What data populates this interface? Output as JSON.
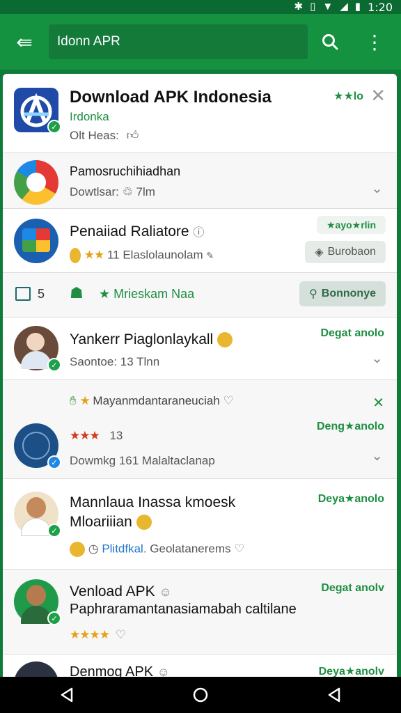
{
  "status_bar": {
    "time": "1:20"
  },
  "app_bar": {
    "search_text": "Idonn APR"
  },
  "rows": [
    {
      "title": "Download APK Indonesia",
      "subtitle": "Irdonka",
      "meta": "Olt Heas:",
      "right_label": "★★lo"
    },
    {
      "title": "Pamosruchihiadhan",
      "meta": "Dowtlsar: ♲ 7lm"
    },
    {
      "title": "Penaiiad Raliatore",
      "meta": "11  Elaslolaunolam",
      "pill_top": "★ayo★rlin",
      "pill_bottom": "Burobaon"
    },
    {
      "count": "5",
      "category": "Mrieskam Naa",
      "button": "Bonnonye"
    },
    {
      "title": "Yankerr Piaglonlaykall",
      "meta": "Saontoe:  13 Tlnn",
      "right_label": "Degat anolo"
    },
    {
      "title": "Mayanmdantaraneuciah",
      "rating_count": "13",
      "meta": "Dowmkg 161 Malaltaclanap",
      "right_label": "Deng★anolo"
    },
    {
      "title_line1": "Mannlaua Inassa kmoesk",
      "title_line2": "Mloariiian",
      "meta_link": "Plitdfkal.",
      "meta": "Geolatanerems",
      "right_label": "Deya★anolo"
    },
    {
      "title_line1": "Venload APK",
      "title_line2": "Paphraramantanasiamabah caltilane",
      "right_label": "Degat anolv"
    },
    {
      "title": "Denmog APK",
      "right_label": "Deya★anolv"
    }
  ]
}
